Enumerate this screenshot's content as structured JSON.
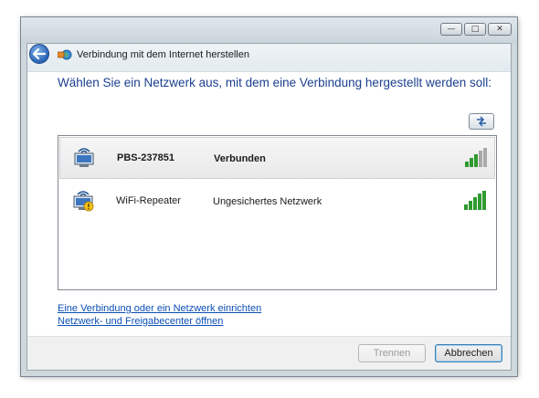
{
  "window": {
    "title": "Verbindung mit dem Internet herstellen",
    "caption_buttons": [
      "minimize",
      "maximize",
      "close"
    ]
  },
  "main": {
    "heading": "Wählen Sie ein Netzwerk aus, mit dem eine Verbindung hergestellt werden soll:",
    "refresh_icon": "refresh-icon"
  },
  "networks": [
    {
      "name": "PBS-237851",
      "status": "Verbunden",
      "selected": true,
      "secured": true,
      "signal_bars": 3,
      "signal_max": 5
    },
    {
      "name": "WiFi-Repeater",
      "status": "Ungesichertes Netzwerk",
      "selected": false,
      "secured": false,
      "signal_bars": 5,
      "signal_max": 5
    }
  ],
  "links": {
    "setup": "Eine Verbindung oder ein Netzwerk einrichten",
    "center": "Netzwerk- und Freigabecenter öffnen"
  },
  "buttons": {
    "disconnect": "Trennen",
    "cancel": "Abbrechen"
  },
  "colors": {
    "heading": "#1b3f8f",
    "link": "#0b4fb4",
    "signal_on": "#2f9a2f",
    "signal_off": "#a9a9a9"
  }
}
